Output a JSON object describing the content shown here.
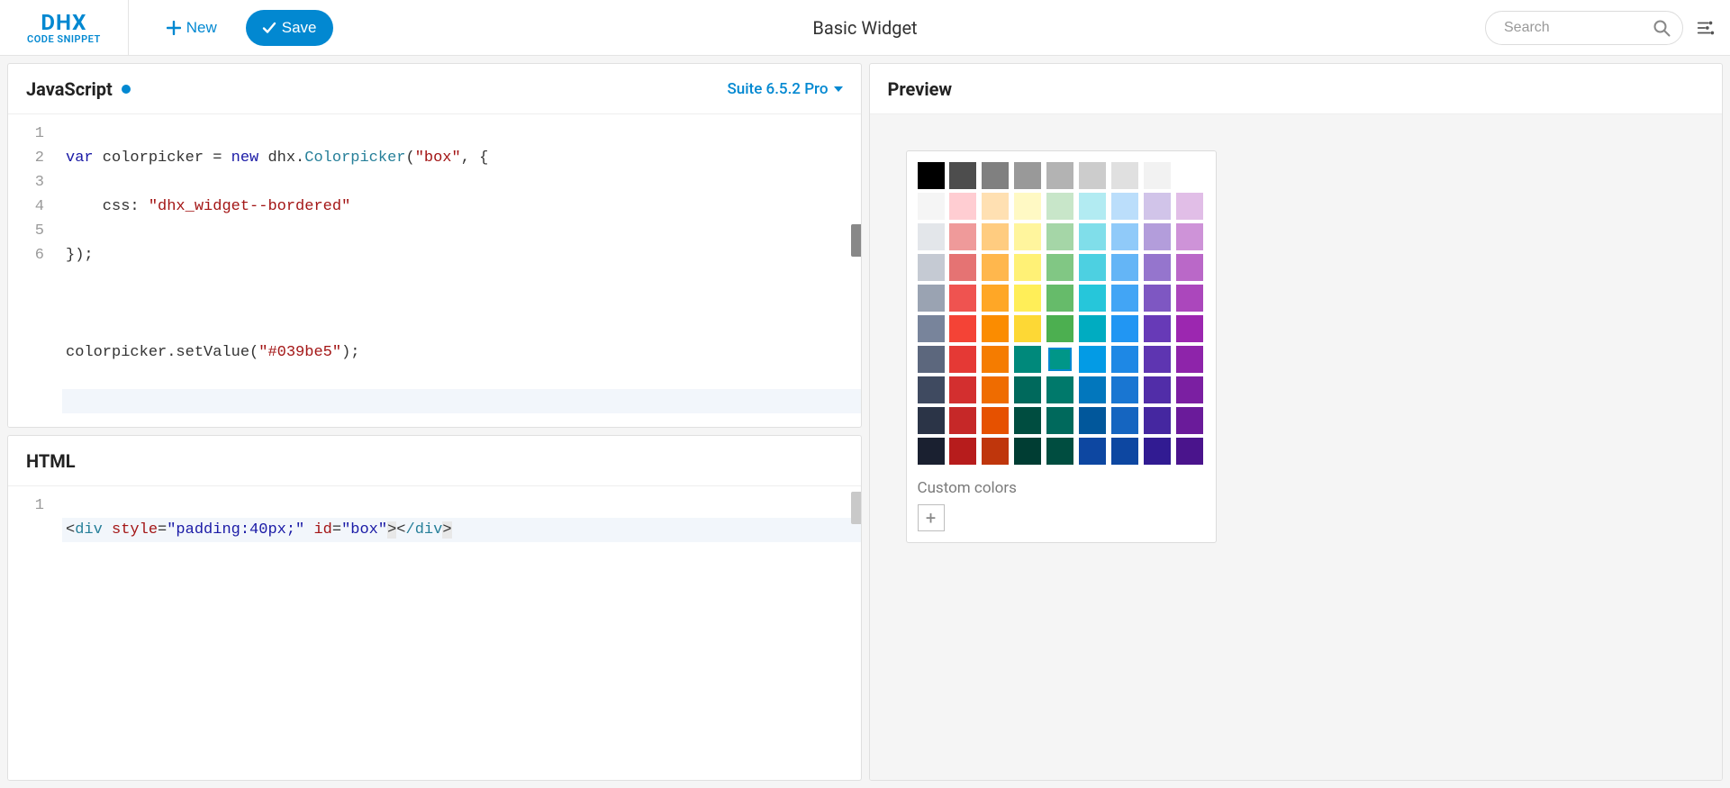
{
  "logo": {
    "brand": "DHX",
    "sub": "CODE SNIPPET"
  },
  "toolbar": {
    "new_label": "New",
    "save_label": "Save",
    "title": "Basic Widget",
    "search_placeholder": "Search"
  },
  "panels": {
    "js": {
      "title": "JavaScript",
      "version_label": "Suite 6.5.2 Pro"
    },
    "html": {
      "title": "HTML"
    },
    "preview": {
      "title": "Preview"
    }
  },
  "code_js": {
    "lines": [
      "1",
      "2",
      "3",
      "4",
      "5",
      "6"
    ],
    "l1": {
      "a": "var",
      "b": " colorpicker = ",
      "c": "new",
      "d": " dhx.",
      "e": "Colorpicker",
      "f": "(",
      "g": "\"box\"",
      "h": ", {"
    },
    "l2": {
      "a": "    css: ",
      "b": "\"dhx_widget--bordered\""
    },
    "l3": {
      "a": "});"
    },
    "l4": {
      "a": ""
    },
    "l5": {
      "a": "colorpicker.setValue(",
      "b": "\"#039be5\"",
      "c": ");"
    },
    "l6": {
      "a": ""
    }
  },
  "code_html": {
    "lines": [
      "1"
    ],
    "l1": {
      "a": "<",
      "b": "div",
      "c": " ",
      "d": "style",
      "e": "=",
      "f": "\"padding:40px;\"",
      "g": " ",
      "h": "id",
      "i": "=",
      "j": "\"box\"",
      "k": ">",
      "l": "<",
      "m": "/div",
      "n": ">"
    }
  },
  "colorpicker": {
    "custom_label": "Custom colors",
    "add_label": "+",
    "selected_index": 58,
    "rows": [
      [
        "#000000",
        "#4d4d4d",
        "#808080",
        "#999999",
        "#b3b3b3",
        "#cccccc",
        "#e0e0e0",
        "#f2f2f2",
        "#ffffff"
      ],
      [
        "#f5f5f5",
        "#ffcdd2",
        "#ffe0b2",
        "#fff9c4",
        "#c8e6c9",
        "#b2ebf2",
        "#bbdefb",
        "#d1c4e9",
        "#e1bee7"
      ],
      [
        "#e3e6ea",
        "#ef9a9a",
        "#ffcc80",
        "#fff59d",
        "#a5d6a7",
        "#80deea",
        "#90caf9",
        "#b39ddb",
        "#ce93d8"
      ],
      [
        "#c5cad3",
        "#e57373",
        "#ffb74d",
        "#fff176",
        "#81c784",
        "#4dd0e1",
        "#64b5f6",
        "#9575cd",
        "#ba68c8"
      ],
      [
        "#9aa3b2",
        "#ef5350",
        "#ffa726",
        "#ffee58",
        "#66bb6a",
        "#26c6da",
        "#42a5f5",
        "#7e57c2",
        "#ab47bc"
      ],
      [
        "#78849b",
        "#f44336",
        "#fb8c00",
        "#fdd835",
        "#4caf50",
        "#00acc1",
        "#2196f3",
        "#673ab7",
        "#9c27b0"
      ],
      [
        "#5c677d",
        "#e53935",
        "#f57c00",
        "#00897b",
        "#009688",
        "#039be5",
        "#1e88e5",
        "#5e35b1",
        "#8e24aa"
      ],
      [
        "#3f4a60",
        "#d32f2f",
        "#ef6c00",
        "#00695c",
        "#00796b",
        "#0277bd",
        "#1976d2",
        "#512da8",
        "#7b1fa2"
      ],
      [
        "#2b3447",
        "#c62828",
        "#e65100",
        "#004d40",
        "#00695c",
        "#01579b",
        "#1565c0",
        "#4527a0",
        "#6a1b9a"
      ],
      [
        "#1a2030",
        "#b71c1c",
        "#bf360c",
        "#003d33",
        "#004d40",
        "#0d47a1",
        "#0d47a1",
        "#311b92",
        "#4a148c"
      ]
    ]
  }
}
